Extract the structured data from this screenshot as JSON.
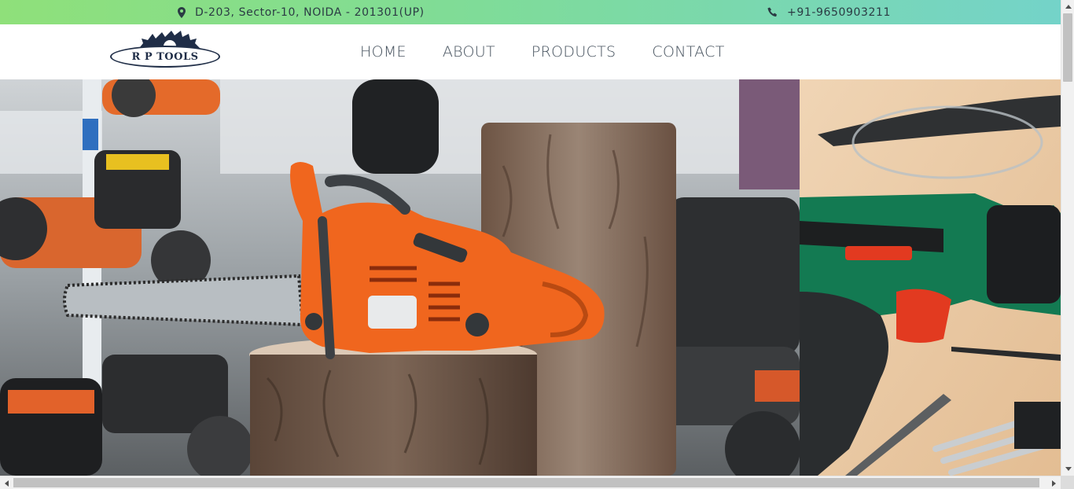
{
  "topbar": {
    "address": "D-203, Sector-10, NOIDA - 201301(UP)",
    "phone": "+91-9650903211",
    "address_icon": "map-marker-icon",
    "phone_icon": "phone-icon"
  },
  "logo": {
    "text": "R P TOOLS"
  },
  "nav": {
    "home": "HOME",
    "about": "ABOUT",
    "products": "PRODUCTS",
    "contact": "CONTACT"
  },
  "hero": {
    "slides": [
      "chainsaw-on-tree-stump-photo",
      "cordless-drill-and-bits-photo"
    ]
  },
  "colors": {
    "topbar_start": "#8fe07a",
    "topbar_end": "#74d3c9",
    "nav_text": "#44505c",
    "accent_orange": "#f0661e"
  }
}
